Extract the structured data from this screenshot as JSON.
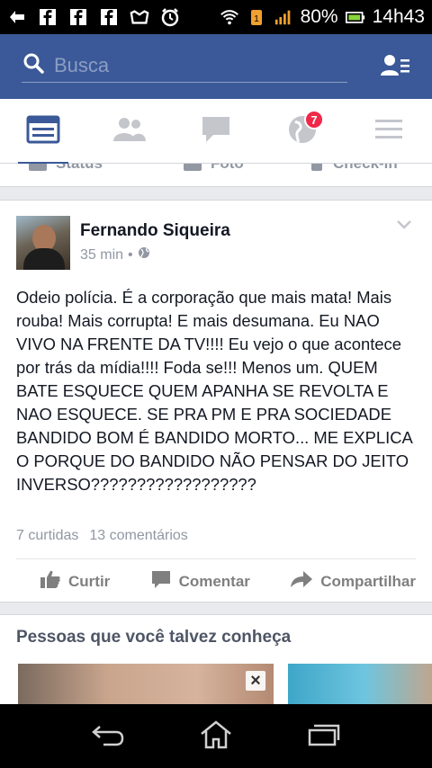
{
  "status_bar": {
    "battery_percent": "80%",
    "time": "14h43",
    "notification_icons": [
      "usb-icon",
      "facebook-icon",
      "facebook-icon",
      "facebook-icon",
      "photo-icon",
      "alarm-icon"
    ],
    "status_icons": [
      "wifi-icon",
      "sim-icon",
      "signal-icon",
      "battery-icon"
    ]
  },
  "search": {
    "placeholder": "Busca",
    "icon": "search-icon",
    "friends_icon": "friend-requests-icon"
  },
  "tabs": [
    {
      "name": "news-feed",
      "icon": "newsfeed-icon",
      "active": true
    },
    {
      "name": "friends",
      "icon": "friends-icon",
      "active": false
    },
    {
      "name": "messages",
      "icon": "messages-icon",
      "active": false
    },
    {
      "name": "notifications",
      "icon": "globe-icon",
      "active": false,
      "badge": "7"
    },
    {
      "name": "more",
      "icon": "menu-icon",
      "active": false
    }
  ],
  "previous_card_labels": {
    "left": "Status",
    "middle": "Foto",
    "right": "Check-in"
  },
  "post": {
    "author": "Fernando Siqueira",
    "time": "35 min",
    "separator": "•",
    "privacy_icon": "public-globe-icon",
    "text": "Odeio polícia. É a corporação que mais mata! Mais rouba! Mais corrupta! E mais desumana. Eu NAO VIVO NA FRENTE DA TV!!!! Eu vejo o que acontece por trás da mídia!!!! Foda se!!! Menos um. QUEM BATE ESQUECE QUEM APANHA SE REVOLTA E NAO ESQUECE. SE PRA PM E PRA SOCIEDADE BANDIDO BOM É BANDIDO MORTO... ME EXPLICA O PORQUE DO BANDIDO NÃO PENSAR DO JEITO INVERSO??????????????????",
    "likes": "7 curtidas",
    "comments": "13 comentários",
    "actions": {
      "like": "Curtir",
      "comment": "Comentar",
      "share": "Compartilhar"
    }
  },
  "pymk": {
    "title": "Pessoas que você talvez conheça",
    "close_symbol": "×"
  },
  "colors": {
    "brand_blue": "#3b5998",
    "badge_red": "#f02849",
    "text_dark": "#141823",
    "text_muted": "#9197a3"
  }
}
